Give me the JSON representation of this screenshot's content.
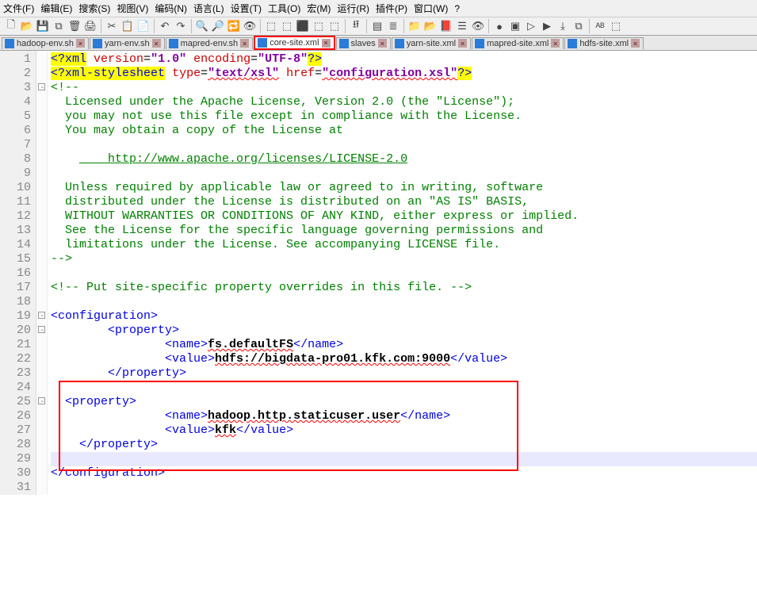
{
  "menu": [
    "文件(F)",
    "编辑(E)",
    "搜索(S)",
    "视图(V)",
    "编码(N)",
    "语言(L)",
    "设置(T)",
    "工具(O)",
    "宏(M)",
    "运行(R)",
    "插件(P)",
    "窗口(W)",
    "?"
  ],
  "toolbar_icons": [
    "🗋",
    "📂",
    "💾",
    "⧉",
    "🗑",
    "🖨",
    "|",
    "✂",
    "📋",
    "📄",
    "|",
    "↶",
    "↷",
    "|",
    "🔍",
    "🔎",
    "🔁",
    "👁",
    "|",
    "⬚",
    "⬚",
    "⬛",
    "⬚",
    "⬚",
    "|",
    "⭿",
    "|",
    "▤",
    "≣",
    "|",
    "📁",
    "📂",
    "📕",
    "☰",
    "👁",
    "|",
    "●",
    "▣",
    "▷",
    "▶",
    "⤓",
    "⧉",
    "|",
    "ᴬᴮ",
    "⬚"
  ],
  "tabs": [
    {
      "label": "hadoop-env.sh",
      "active": false
    },
    {
      "label": "yarn-env.sh",
      "active": false
    },
    {
      "label": "mapred-env.sh",
      "active": false
    },
    {
      "label": "core-site.xml",
      "active": true
    },
    {
      "label": "slaves",
      "active": false
    },
    {
      "label": "yarn-site.xml",
      "active": false
    },
    {
      "label": "mapred-site.xml",
      "active": false
    },
    {
      "label": "hdfs-site.xml",
      "active": false
    }
  ],
  "lines": {
    "l1": {
      "p": "<?",
      "t": "xml",
      "a1": "version",
      "v1": "\"1.0\"",
      "a2": "encoding",
      "v2": "\"UTF-8\"",
      "s": "?>"
    },
    "l2": {
      "p": "<?",
      "t": "xml-stylesheet",
      "a1": "type",
      "v1": "\"text/xsl\"",
      "a2": "href",
      "v2": "\"configuration.xsl\"",
      "s": "?>"
    },
    "l3": "<!--",
    "l4": "  Licensed under the Apache License, Version 2.0 (the \"License\");",
    "l5": "  you may not use this file except in compliance with the License.",
    "l6": "  You may obtain a copy of the License at",
    "l7": "",
    "l8": "    http://www.apache.org/licenses/LICENSE-2.0",
    "l9": "",
    "l10": "  Unless required by applicable law or agreed to in writing, software",
    "l11": "  distributed under the License is distributed on an \"AS IS\" BASIS,",
    "l12": "  WITHOUT WARRANTIES OR CONDITIONS OF ANY KIND, either express or implied.",
    "l13": "  See the License for the specific language governing permissions and",
    "l14": "  limitations under the License. See accompanying LICENSE file.",
    "l15": "-->",
    "l16": "",
    "l17": "<!-- Put site-specific property overrides in this file. -->",
    "l18": "",
    "cfg_open": "<configuration>",
    "prop_open": "        <property>",
    "name_open": "<name>",
    "name_close": "</name>",
    "val_open": "<value>",
    "val_close": "</value>",
    "name1": "fs.defaultFS",
    "val1": "hdfs://bigdata-pro01.kfk.com:9000",
    "prop_close": "        </property>",
    "prop2_open": "  <property>",
    "name2": "hadoop.http.staticuser.user",
    "val2": "kfk",
    "prop2_close": "    </property>",
    "cfg_close": "</configuration>"
  }
}
